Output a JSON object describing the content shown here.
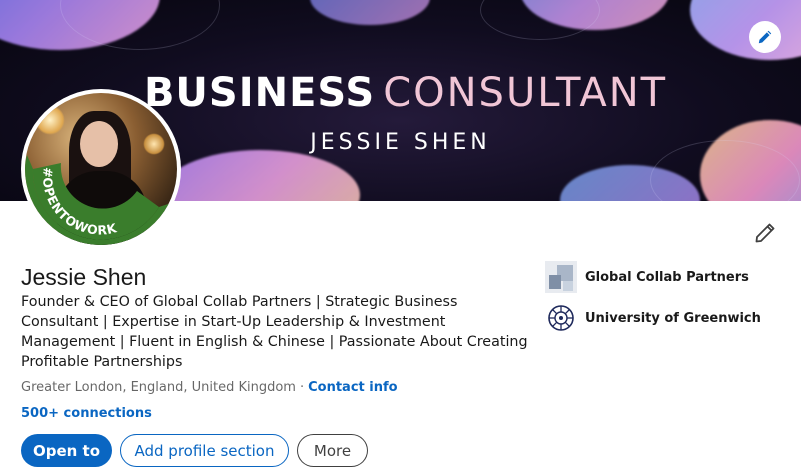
{
  "banner": {
    "title_bold": "BUSINESS",
    "title_light": "CONSULTANT",
    "subtitle": "JESSIE SHEN"
  },
  "avatar": {
    "badge_text": "#OPENTOWORK"
  },
  "profile": {
    "name": "Jessie Shen",
    "headline": "Founder & CEO of Global Collab Partners | Strategic Business Consultant | Expertise in Start-Up Leadership & Investment Management | Fluent in English & Chinese | Passionate About Creating Profitable Partnerships",
    "location": "Greater London, England, United Kingdom",
    "separator": "·",
    "contact_link": "Contact info",
    "connections": "500+ connections"
  },
  "actions": {
    "open_to": "Open to",
    "add_section": "Add profile section",
    "more": "More"
  },
  "sidebar": {
    "items": [
      {
        "label": "Global Collab Partners",
        "icon": "company-logo-icon"
      },
      {
        "label": "University of Greenwich",
        "icon": "university-crest-icon"
      }
    ]
  },
  "colors": {
    "accent": "#0a66c2",
    "open_to_work": "#3a7d2c"
  }
}
